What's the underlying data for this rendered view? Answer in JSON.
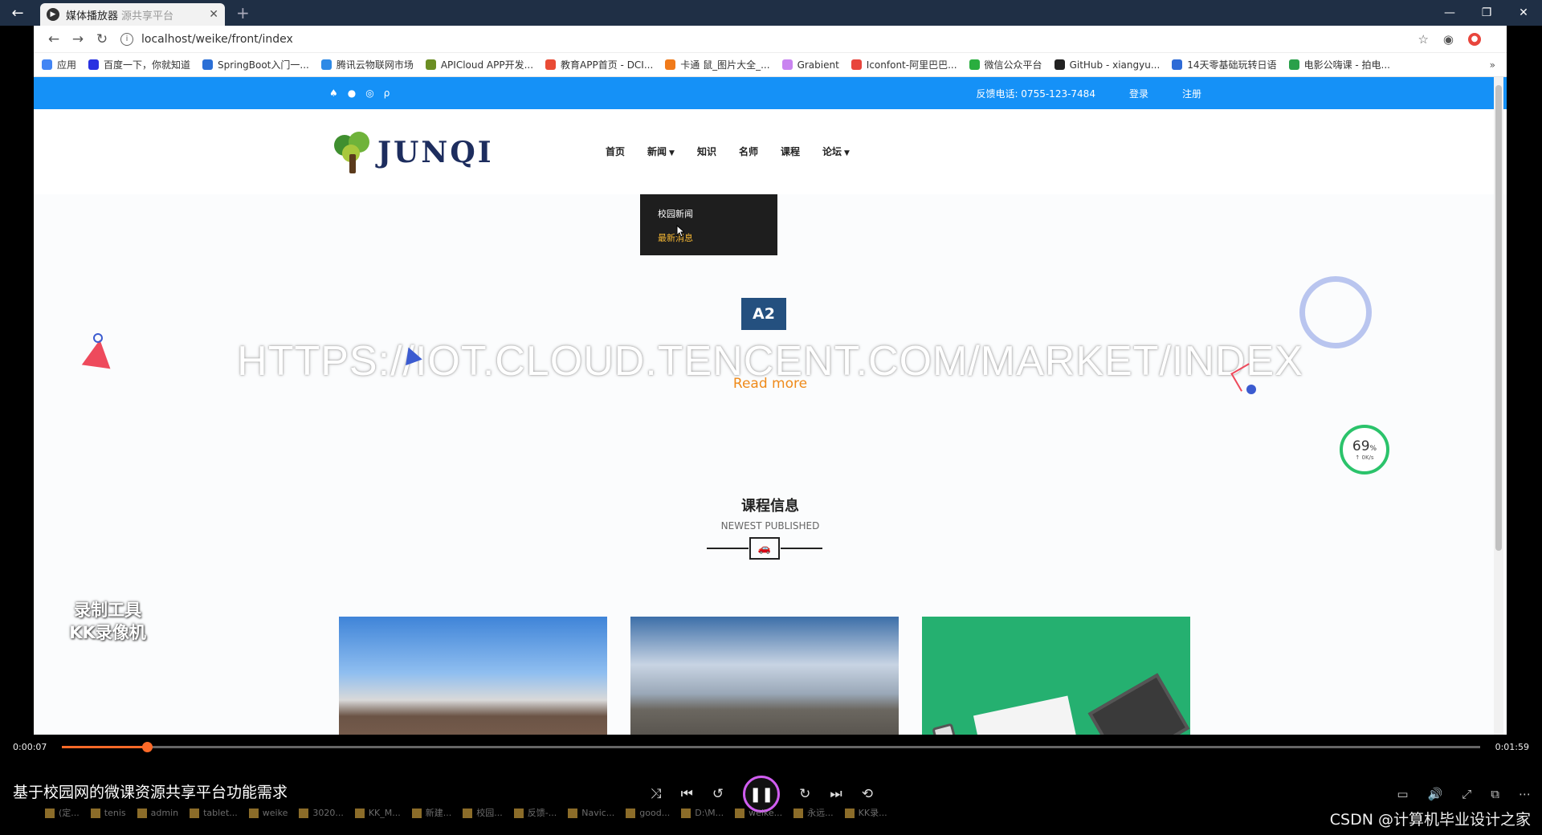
{
  "player": {
    "tab_title": "媒体播放器",
    "tab_subtitle": "源共享平台",
    "video_title": "基于校园网的微课资源共享平台功能需求",
    "time_current": "0:00:07",
    "time_total": "0:01:59",
    "progress_fraction": 0.06,
    "accent_color": "#ff6a28",
    "watermark_text": "录制工具\nKK录像机",
    "csdn_text": "CSDN @计算机毕业设计之家"
  },
  "browser": {
    "url": "localhost/weike/front/index",
    "bookmarks": [
      {
        "label": "应用",
        "color": "#4285f4"
      },
      {
        "label": "百度一下，你就知道",
        "color": "#2932e1"
      },
      {
        "label": "SpringBoot入门一...",
        "color": "#2b6fd6"
      },
      {
        "label": "腾讯云物联网市场",
        "color": "#2e8ae6"
      },
      {
        "label": "APICloud APP开发...",
        "color": "#6b8e23"
      },
      {
        "label": "教育APP首页 - DCI...",
        "color": "#e94b35"
      },
      {
        "label": "卡通 鼠_图片大全_...",
        "color": "#f07a1a"
      },
      {
        "label": "Grabient",
        "color": "#c984f0"
      },
      {
        "label": "Iconfont-阿里巴巴...",
        "color": "#e8453c"
      },
      {
        "label": "微信公众平台",
        "color": "#2aae3f"
      },
      {
        "label": "GitHub - xiangyu...",
        "color": "#222222"
      },
      {
        "label": "14天零基础玩转日语",
        "color": "#2e6bd6"
      },
      {
        "label": "电影公嗨课 - 拍电...",
        "color": "#2aa04a"
      }
    ]
  },
  "site": {
    "phone": "反馈电话: 0755-123-7484",
    "login": "登录",
    "register": "注册",
    "logo_text": "JUNQI",
    "nav": [
      {
        "label": "首页",
        "caret": false
      },
      {
        "label": "新闻",
        "caret": true
      },
      {
        "label": "知识",
        "caret": false
      },
      {
        "label": "名师",
        "caret": false
      },
      {
        "label": "课程",
        "caret": false
      },
      {
        "label": "论坛",
        "caret": true
      }
    ],
    "dropdown": [
      "校园新闻",
      "最新消息"
    ],
    "hero": {
      "badge": "A2",
      "title": "HTTPS://IOT.CLOUD.TENCENT.COM/MARKET/INDEX",
      "read_more": "Read more"
    },
    "speed": {
      "pct": "69",
      "unit": "%",
      "rate": "↑ 0K/s"
    },
    "section": {
      "title": "课程信息",
      "subtitle": "NEWEST PUBLISHED"
    }
  },
  "taskbar": [
    "(定...",
    "tenis",
    "admin",
    "tablet...",
    "weike",
    "3020...",
    "KK_M...",
    "新建...",
    "校园...",
    "反馈-...",
    "Navic...",
    "good...",
    "D:\\M...",
    "weike...",
    "永远...",
    "KK录..."
  ]
}
